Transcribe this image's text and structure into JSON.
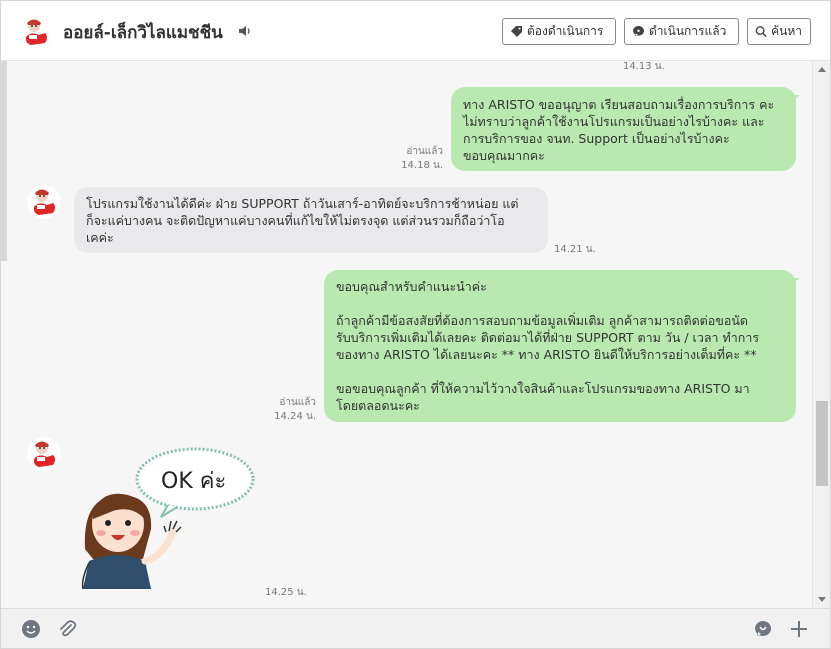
{
  "header": {
    "contact_name": "ออยล์-เล็กวิไลแมชชีน",
    "btn_todo": "ต้องดำเนินการ",
    "btn_done": "ดำเนินการแล้ว",
    "btn_search": "ค้นหา"
  },
  "messages": [
    {
      "type": "out",
      "text": "ทาง ARISTO ขออนุญาต เรียนสอบถามเรื่องการบริการ คะ\nไม่ทราบว่าลูกค้าใช้งานโปรแกรมเป็นอย่างไรบ้างคะ และ\nการบริการของ จนท. Support เป็นอย่างไรบ้างคะ\nขอบคุณมากคะ",
      "read": "อ่านแล้ว",
      "time": "14.18 น."
    },
    {
      "type": "in",
      "text": "โปรแกรมใช้งานได้ดีค่ะ ฝ่าย SUPPORT ถ้าวันเสาร์-อาทิตย์จะบริการช้าหน่อย แต่\nก็จะแค่บางคน จะติดปัญหาแค่บางคนที่แก้ไขให้ไม่ตรงจุด แต่ส่วนรวมก็ถือว่าโอ\nเคค่ะ",
      "time": "14.21 น."
    },
    {
      "type": "out",
      "text": "ขอบคุณสำหรับคำแนะนำค่ะ\n\nถ้าลูกค้ามีข้อสงสัยที่ต้องการสอบถามข้อมูลเพิ่มเติม ลูกค้าสามารถติดต่อขอนัด\nรับบริการเพิ่มเติมได้เลยคะ ติดต่อมาได้ที่ฝ่าย SUPPORT ตาม วัน / เวลา ทำการ\nของทาง ARISTO ได้เลยนะคะ ** ทาง ARISTO ยินดีให้บริการอย่างเต็มที่คะ **\n\nขอขอบคุณลูกค้า ที่ให้ความไว้วางใจสินค้าและโปรแกรมของทาง ARISTO มา\nโดยตลอดนะคะ",
      "read": "อ่านแล้ว",
      "time": "14.24 น."
    },
    {
      "type": "sticker",
      "sticker_text": "OK ค่ะ",
      "time": "14.25 น."
    }
  ],
  "top_partial_time": "14.13 น."
}
